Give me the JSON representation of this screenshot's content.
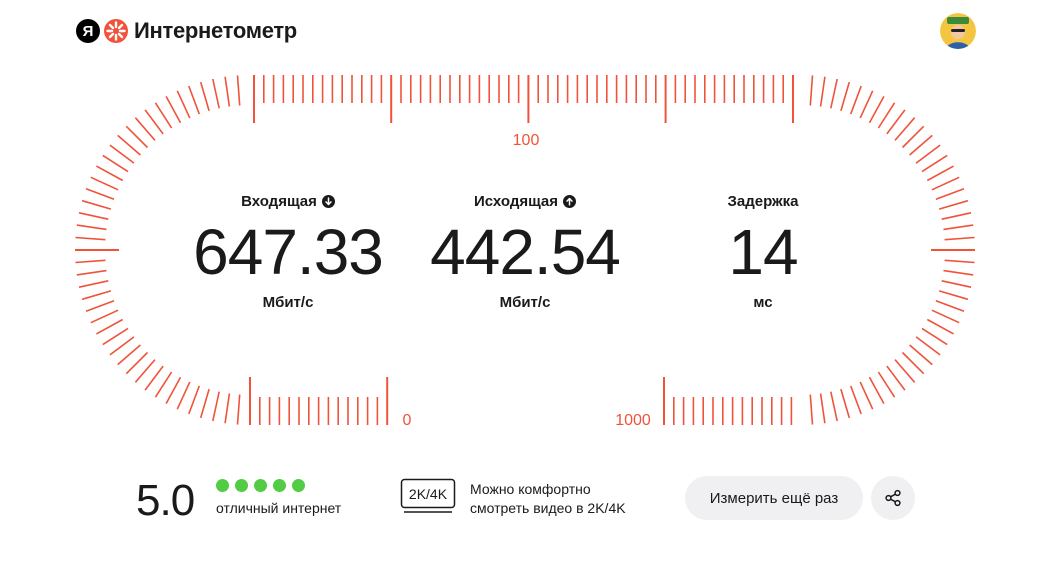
{
  "header": {
    "logo_letter": "Я",
    "title": "Интернетометр"
  },
  "gauge": {
    "color": "#f0533a",
    "labels": {
      "top": "100",
      "bottom_left": "0",
      "bottom_right": "1000"
    }
  },
  "metrics": {
    "download": {
      "label": "Входящая",
      "value": "647.33",
      "unit": "Мбит/с",
      "icon": "arrow-down-icon"
    },
    "upload": {
      "label": "Исходящая",
      "value": "442.54",
      "unit": "Мбит/с",
      "icon": "arrow-up-icon"
    },
    "latency": {
      "label": "Задержка",
      "value": "14",
      "unit": "мс"
    }
  },
  "rating": {
    "score": "5.0",
    "filled_dots": 5,
    "total_dots": 5,
    "dot_color": "#52cc45",
    "text": "отличный интернет"
  },
  "quality": {
    "badge": "2K/4K",
    "text_line1": "Можно комфортно",
    "text_line2": "смотреть видео в 2K/4K"
  },
  "actions": {
    "retry_label": "Измерить ещё раз",
    "share_icon": "share-icon"
  }
}
